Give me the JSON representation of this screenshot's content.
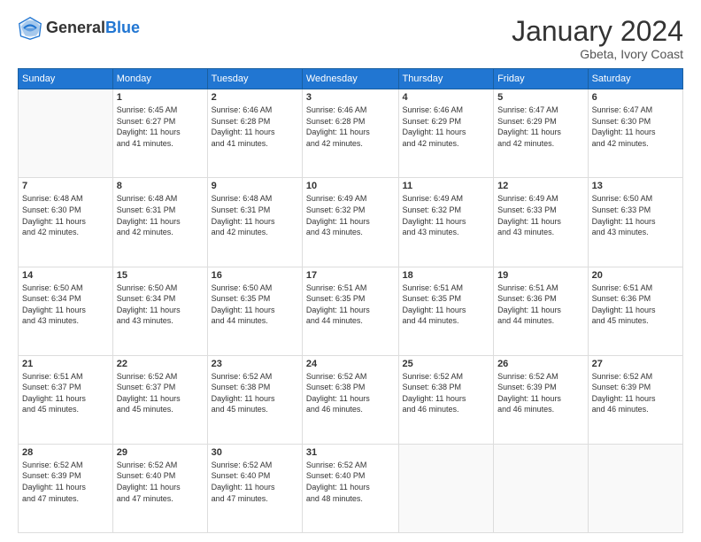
{
  "header": {
    "logo_general": "General",
    "logo_blue": "Blue",
    "month_title": "January 2024",
    "location": "Gbeta, Ivory Coast"
  },
  "days_of_week": [
    "Sunday",
    "Monday",
    "Tuesday",
    "Wednesday",
    "Thursday",
    "Friday",
    "Saturday"
  ],
  "weeks": [
    [
      {
        "day": "",
        "info": ""
      },
      {
        "day": "1",
        "info": "Sunrise: 6:45 AM\nSunset: 6:27 PM\nDaylight: 11 hours\nand 41 minutes."
      },
      {
        "day": "2",
        "info": "Sunrise: 6:46 AM\nSunset: 6:28 PM\nDaylight: 11 hours\nand 41 minutes."
      },
      {
        "day": "3",
        "info": "Sunrise: 6:46 AM\nSunset: 6:28 PM\nDaylight: 11 hours\nand 42 minutes."
      },
      {
        "day": "4",
        "info": "Sunrise: 6:46 AM\nSunset: 6:29 PM\nDaylight: 11 hours\nand 42 minutes."
      },
      {
        "day": "5",
        "info": "Sunrise: 6:47 AM\nSunset: 6:29 PM\nDaylight: 11 hours\nand 42 minutes."
      },
      {
        "day": "6",
        "info": "Sunrise: 6:47 AM\nSunset: 6:30 PM\nDaylight: 11 hours\nand 42 minutes."
      }
    ],
    [
      {
        "day": "7",
        "info": "Sunrise: 6:48 AM\nSunset: 6:30 PM\nDaylight: 11 hours\nand 42 minutes."
      },
      {
        "day": "8",
        "info": "Sunrise: 6:48 AM\nSunset: 6:31 PM\nDaylight: 11 hours\nand 42 minutes."
      },
      {
        "day": "9",
        "info": "Sunrise: 6:48 AM\nSunset: 6:31 PM\nDaylight: 11 hours\nand 42 minutes."
      },
      {
        "day": "10",
        "info": "Sunrise: 6:49 AM\nSunset: 6:32 PM\nDaylight: 11 hours\nand 43 minutes."
      },
      {
        "day": "11",
        "info": "Sunrise: 6:49 AM\nSunset: 6:32 PM\nDaylight: 11 hours\nand 43 minutes."
      },
      {
        "day": "12",
        "info": "Sunrise: 6:49 AM\nSunset: 6:33 PM\nDaylight: 11 hours\nand 43 minutes."
      },
      {
        "day": "13",
        "info": "Sunrise: 6:50 AM\nSunset: 6:33 PM\nDaylight: 11 hours\nand 43 minutes."
      }
    ],
    [
      {
        "day": "14",
        "info": "Sunrise: 6:50 AM\nSunset: 6:34 PM\nDaylight: 11 hours\nand 43 minutes."
      },
      {
        "day": "15",
        "info": "Sunrise: 6:50 AM\nSunset: 6:34 PM\nDaylight: 11 hours\nand 43 minutes."
      },
      {
        "day": "16",
        "info": "Sunrise: 6:50 AM\nSunset: 6:35 PM\nDaylight: 11 hours\nand 44 minutes."
      },
      {
        "day": "17",
        "info": "Sunrise: 6:51 AM\nSunset: 6:35 PM\nDaylight: 11 hours\nand 44 minutes."
      },
      {
        "day": "18",
        "info": "Sunrise: 6:51 AM\nSunset: 6:35 PM\nDaylight: 11 hours\nand 44 minutes."
      },
      {
        "day": "19",
        "info": "Sunrise: 6:51 AM\nSunset: 6:36 PM\nDaylight: 11 hours\nand 44 minutes."
      },
      {
        "day": "20",
        "info": "Sunrise: 6:51 AM\nSunset: 6:36 PM\nDaylight: 11 hours\nand 45 minutes."
      }
    ],
    [
      {
        "day": "21",
        "info": "Sunrise: 6:51 AM\nSunset: 6:37 PM\nDaylight: 11 hours\nand 45 minutes."
      },
      {
        "day": "22",
        "info": "Sunrise: 6:52 AM\nSunset: 6:37 PM\nDaylight: 11 hours\nand 45 minutes."
      },
      {
        "day": "23",
        "info": "Sunrise: 6:52 AM\nSunset: 6:38 PM\nDaylight: 11 hours\nand 45 minutes."
      },
      {
        "day": "24",
        "info": "Sunrise: 6:52 AM\nSunset: 6:38 PM\nDaylight: 11 hours\nand 46 minutes."
      },
      {
        "day": "25",
        "info": "Sunrise: 6:52 AM\nSunset: 6:38 PM\nDaylight: 11 hours\nand 46 minutes."
      },
      {
        "day": "26",
        "info": "Sunrise: 6:52 AM\nSunset: 6:39 PM\nDaylight: 11 hours\nand 46 minutes."
      },
      {
        "day": "27",
        "info": "Sunrise: 6:52 AM\nSunset: 6:39 PM\nDaylight: 11 hours\nand 46 minutes."
      }
    ],
    [
      {
        "day": "28",
        "info": "Sunrise: 6:52 AM\nSunset: 6:39 PM\nDaylight: 11 hours\nand 47 minutes."
      },
      {
        "day": "29",
        "info": "Sunrise: 6:52 AM\nSunset: 6:40 PM\nDaylight: 11 hours\nand 47 minutes."
      },
      {
        "day": "30",
        "info": "Sunrise: 6:52 AM\nSunset: 6:40 PM\nDaylight: 11 hours\nand 47 minutes."
      },
      {
        "day": "31",
        "info": "Sunrise: 6:52 AM\nSunset: 6:40 PM\nDaylight: 11 hours\nand 48 minutes."
      },
      {
        "day": "",
        "info": ""
      },
      {
        "day": "",
        "info": ""
      },
      {
        "day": "",
        "info": ""
      }
    ]
  ]
}
